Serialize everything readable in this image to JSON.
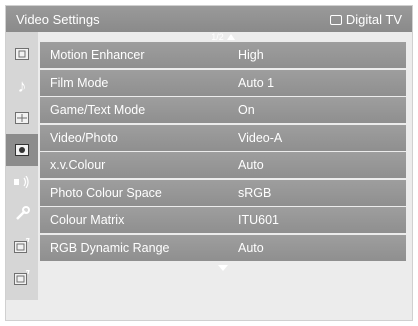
{
  "header": {
    "title": "Video Settings",
    "source": "Digital TV"
  },
  "page_indicator": "1/2",
  "sidebar": {
    "items": [
      {
        "icon": "picture-icon"
      },
      {
        "icon": "music-note-icon"
      },
      {
        "icon": "aspect-ratio-icon"
      },
      {
        "icon": "video-settings-icon",
        "active": true
      },
      {
        "icon": "speaker-icon"
      },
      {
        "icon": "wrench-icon"
      },
      {
        "icon": "input-a-icon"
      },
      {
        "icon": "input-b-icon"
      }
    ]
  },
  "settings": [
    {
      "label": "Motion Enhancer",
      "value": "High"
    },
    {
      "label": "Film Mode",
      "value": "Auto 1"
    },
    {
      "label": "Game/Text Mode",
      "value": "On"
    },
    {
      "label": "Video/Photo",
      "value": "Video-A"
    },
    {
      "label": "x.v.Colour",
      "value": "Auto"
    },
    {
      "label": "Photo Colour Space",
      "value": "sRGB"
    },
    {
      "label": "Colour Matrix",
      "value": "ITU601"
    },
    {
      "label": "RGB Dynamic Range",
      "value": "Auto"
    }
  ]
}
